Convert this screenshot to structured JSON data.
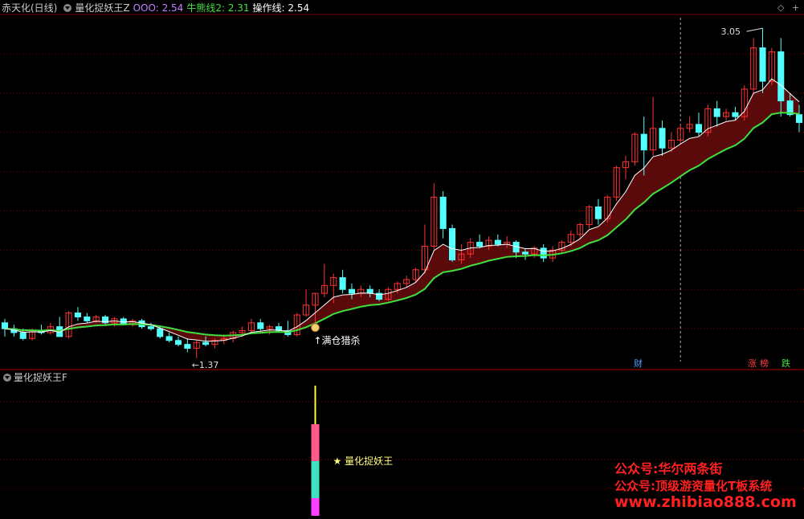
{
  "header": {
    "title": "赤天化(日线)",
    "indicator_name": "量化捉妖王Z",
    "items": [
      {
        "label": "OOO: 2.54",
        "color": "#c080ff"
      },
      {
        "label": "牛熊线2: 2.31",
        "color": "#40e040"
      },
      {
        "label": "操作线: 2.54",
        "color": "#ffffff"
      }
    ]
  },
  "lower_panel": {
    "title": "量化捉妖王F"
  },
  "annotations": {
    "high": "3.05",
    "low": "←1.37",
    "signal": "↑满仓猎杀",
    "lower_signal": "★ 量化捉妖王",
    "tag_cai": "财",
    "tag_zhang": "涨",
    "tag_bang": "榜",
    "tag_die": "跌"
  },
  "watermark": {
    "line1": "公众号:华尔两条街",
    "line2": "公众号:顶级游资量化T板系统",
    "line3": "www.zhibiao888.com"
  },
  "colors": {
    "up": "#ff3232",
    "down": "#54ffff",
    "ribbon": "#5a0a0a",
    "bull_line": "#40e040",
    "op_line": "#ffffff",
    "grid": "#7a0000",
    "watermark": "#ff2020"
  },
  "chart_data": {
    "type": "candlestick",
    "candles": [
      [
        1.55,
        1.57,
        1.48,
        1.52
      ],
      [
        1.52,
        1.54,
        1.48,
        1.5
      ],
      [
        1.5,
        1.52,
        1.46,
        1.47
      ],
      [
        1.47,
        1.52,
        1.46,
        1.51
      ],
      [
        1.51,
        1.54,
        1.49,
        1.5
      ],
      [
        1.5,
        1.55,
        1.49,
        1.53
      ],
      [
        1.53,
        1.58,
        1.48,
        1.48
      ],
      [
        1.48,
        1.61,
        1.47,
        1.6
      ],
      [
        1.6,
        1.63,
        1.56,
        1.58
      ],
      [
        1.58,
        1.6,
        1.55,
        1.56
      ],
      [
        1.56,
        1.59,
        1.55,
        1.58
      ],
      [
        1.58,
        1.59,
        1.54,
        1.55
      ],
      [
        1.55,
        1.58,
        1.53,
        1.57
      ],
      [
        1.57,
        1.58,
        1.54,
        1.54
      ],
      [
        1.54,
        1.57,
        1.53,
        1.56
      ],
      [
        1.56,
        1.57,
        1.52,
        1.53
      ],
      [
        1.53,
        1.55,
        1.51,
        1.52
      ],
      [
        1.52,
        1.53,
        1.47,
        1.48
      ],
      [
        1.48,
        1.5,
        1.45,
        1.46
      ],
      [
        1.46,
        1.48,
        1.43,
        1.44
      ],
      [
        1.44,
        1.47,
        1.4,
        1.42
      ],
      [
        1.42,
        1.46,
        1.37,
        1.45
      ],
      [
        1.45,
        1.48,
        1.43,
        1.44
      ],
      [
        1.44,
        1.47,
        1.42,
        1.46
      ],
      [
        1.46,
        1.49,
        1.44,
        1.47
      ],
      [
        1.47,
        1.51,
        1.45,
        1.5
      ],
      [
        1.5,
        1.53,
        1.48,
        1.51
      ],
      [
        1.51,
        1.57,
        1.5,
        1.55
      ],
      [
        1.55,
        1.57,
        1.51,
        1.52
      ],
      [
        1.52,
        1.54,
        1.49,
        1.53
      ],
      [
        1.53,
        1.55,
        1.5,
        1.51
      ],
      [
        1.51,
        1.56,
        1.48,
        1.49
      ],
      [
        1.49,
        1.6,
        1.48,
        1.59
      ],
      [
        1.59,
        1.72,
        1.58,
        1.64
      ],
      [
        1.64,
        1.7,
        1.55,
        1.7
      ],
      [
        1.7,
        1.85,
        1.68,
        1.74
      ],
      [
        1.74,
        1.8,
        1.65,
        1.78
      ],
      [
        1.78,
        1.82,
        1.7,
        1.72
      ],
      [
        1.72,
        1.75,
        1.67,
        1.7
      ],
      [
        1.7,
        1.74,
        1.68,
        1.72
      ],
      [
        1.72,
        1.74,
        1.68,
        1.7
      ],
      [
        1.7,
        1.72,
        1.66,
        1.67
      ],
      [
        1.67,
        1.73,
        1.66,
        1.72
      ],
      [
        1.72,
        1.76,
        1.7,
        1.75
      ],
      [
        1.75,
        1.79,
        1.73,
        1.77
      ],
      [
        1.77,
        1.83,
        1.76,
        1.82
      ],
      [
        1.82,
        2.05,
        1.8,
        1.94
      ],
      [
        1.94,
        2.26,
        1.92,
        2.19
      ],
      [
        2.19,
        2.22,
        1.98,
        2.03
      ],
      [
        2.03,
        2.05,
        1.86,
        1.87
      ],
      [
        1.87,
        1.95,
        1.85,
        1.9
      ],
      [
        1.9,
        1.98,
        1.88,
        1.96
      ],
      [
        1.96,
        2.0,
        1.93,
        1.94
      ],
      [
        1.94,
        1.99,
        1.92,
        1.97
      ],
      [
        1.97,
        2.0,
        1.94,
        1.95
      ],
      [
        1.95,
        1.99,
        1.93,
        1.96
      ],
      [
        1.96,
        1.97,
        1.88,
        1.91
      ],
      [
        1.91,
        1.93,
        1.87,
        1.9
      ],
      [
        1.9,
        1.94,
        1.88,
        1.93
      ],
      [
        1.93,
        1.95,
        1.86,
        1.88
      ],
      [
        1.88,
        1.94,
        1.86,
        1.92
      ],
      [
        1.92,
        1.97,
        1.9,
        1.96
      ],
      [
        1.96,
        2.02,
        1.94,
        2.0
      ],
      [
        2.0,
        2.06,
        1.98,
        2.05
      ],
      [
        2.05,
        2.15,
        2.03,
        2.14
      ],
      [
        2.14,
        2.18,
        2.05,
        2.08
      ],
      [
        2.08,
        2.2,
        2.06,
        2.19
      ],
      [
        2.19,
        2.35,
        2.17,
        2.34
      ],
      [
        2.34,
        2.4,
        2.28,
        2.37
      ],
      [
        2.37,
        2.52,
        2.35,
        2.51
      ],
      [
        2.51,
        2.6,
        2.3,
        2.43
      ],
      [
        2.43,
        2.7,
        2.4,
        2.54
      ],
      [
        2.54,
        2.58,
        2.4,
        2.44
      ],
      [
        2.44,
        2.52,
        2.42,
        2.48
      ],
      [
        2.48,
        2.56,
        2.46,
        2.54
      ],
      [
        2.54,
        2.6,
        2.52,
        2.56
      ],
      [
        2.56,
        2.62,
        2.5,
        2.52
      ],
      [
        2.52,
        2.66,
        2.5,
        2.64
      ],
      [
        2.64,
        2.68,
        2.55,
        2.6
      ],
      [
        2.6,
        2.64,
        2.58,
        2.62
      ],
      [
        2.62,
        2.65,
        2.58,
        2.6
      ],
      [
        2.6,
        2.76,
        2.58,
        2.74
      ],
      [
        2.74,
        3.0,
        2.72,
        2.95
      ],
      [
        2.95,
        3.05,
        2.72,
        2.78
      ],
      [
        2.78,
        2.95,
        2.76,
        2.93
      ],
      [
        2.93,
        3.0,
        2.6,
        2.68
      ],
      [
        2.68,
        2.72,
        2.6,
        2.61
      ],
      [
        2.61,
        2.66,
        2.52,
        2.57
      ]
    ],
    "signal_index": 34,
    "ylim": [
      1.32,
      3.12
    ]
  }
}
